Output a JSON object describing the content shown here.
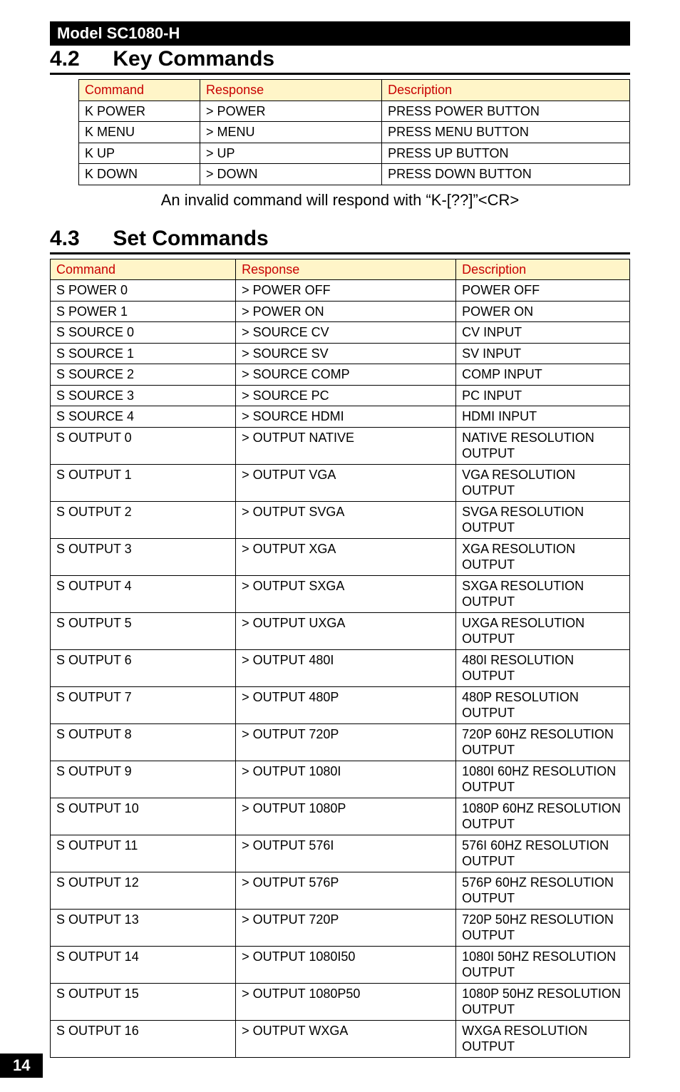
{
  "model_bar": "Model SC1080-H",
  "section42": {
    "num": "4.2",
    "title": "Key Commands"
  },
  "table_key": {
    "headers": [
      "Command",
      "Response",
      "Description"
    ],
    "rows": [
      [
        "K POWER",
        "> POWER",
        "PRESS POWER BUTTON"
      ],
      [
        "K MENU",
        "> MENU",
        "PRESS MENU BUTTON"
      ],
      [
        "K UP",
        "> UP",
        "PRESS UP BUTTON"
      ],
      [
        "K DOWN",
        "> DOWN",
        "PRESS DOWN BUTTON"
      ]
    ]
  },
  "invalid_caption": "An invalid command will respond with “K-[??]”<CR>",
  "section43": {
    "num": "4.3",
    "title": "Set Commands"
  },
  "table_set": {
    "headers": [
      "Command",
      "Response",
      "Description"
    ],
    "rows": [
      [
        "S POWER 0",
        "> POWER OFF",
        "POWER OFF"
      ],
      [
        "S POWER 1",
        "> POWER ON",
        "POWER ON"
      ],
      [
        "S SOURCE 0",
        "> SOURCE CV",
        "CV INPUT"
      ],
      [
        "S SOURCE 1",
        "> SOURCE SV",
        "SV INPUT"
      ],
      [
        "S SOURCE 2",
        "> SOURCE COMP",
        "COMP INPUT"
      ],
      [
        "S SOURCE 3",
        "> SOURCE PC",
        "PC INPUT"
      ],
      [
        "S SOURCE 4",
        "> SOURCE HDMI",
        "HDMI INPUT"
      ],
      [
        "S OUTPUT 0",
        "> OUTPUT NATIVE",
        "NATIVE RESOLUTION OUTPUT"
      ],
      [
        "S OUTPUT 1",
        "> OUTPUT VGA",
        "VGA RESOLUTION OUTPUT"
      ],
      [
        "S OUTPUT 2",
        "> OUTPUT SVGA",
        "SVGA RESOLUTION OUTPUT"
      ],
      [
        "S OUTPUT 3",
        "> OUTPUT XGA",
        "XGA RESOLUTION OUTPUT"
      ],
      [
        "S OUTPUT 4",
        "> OUTPUT SXGA",
        "SXGA RESOLUTION OUTPUT"
      ],
      [
        "S OUTPUT 5",
        "> OUTPUT UXGA",
        "UXGA RESOLUTION OUTPUT"
      ],
      [
        "S OUTPUT 6",
        "> OUTPUT 480I",
        "480I RESOLUTION OUTPUT"
      ],
      [
        "S OUTPUT 7",
        "> OUTPUT 480P",
        "480P RESOLUTION OUTPUT"
      ],
      [
        "S OUTPUT 8",
        "> OUTPUT 720P",
        "720P 60HZ RESOLUTION OUTPUT"
      ],
      [
        "S OUTPUT 9",
        "> OUTPUT 1080I",
        "1080I 60HZ RESOLUTION OUTPUT"
      ],
      [
        "S OUTPUT 10",
        "> OUTPUT 1080P",
        "1080P 60HZ RESOLUTION OUTPUT"
      ],
      [
        "S OUTPUT 11",
        "> OUTPUT 576I",
        "576I 60HZ RESOLUTION OUTPUT"
      ],
      [
        "S OUTPUT 12",
        "> OUTPUT 576P",
        "576P 60HZ RESOLUTION OUTPUT"
      ],
      [
        "S OUTPUT 13",
        "> OUTPUT 720P",
        "720P 50HZ RESOLUTION OUTPUT"
      ],
      [
        "S OUTPUT 14",
        "> OUTPUT 1080I50",
        "1080I 50HZ RESOLUTION OUTPUT"
      ],
      [
        "S OUTPUT 15",
        "> OUTPUT 1080P50",
        "1080P 50HZ RESOLUTION OUTPUT"
      ],
      [
        "S OUTPUT 16",
        "> OUTPUT WXGA",
        "WXGA RESOLUTION OUTPUT"
      ]
    ]
  },
  "page_number": "14"
}
